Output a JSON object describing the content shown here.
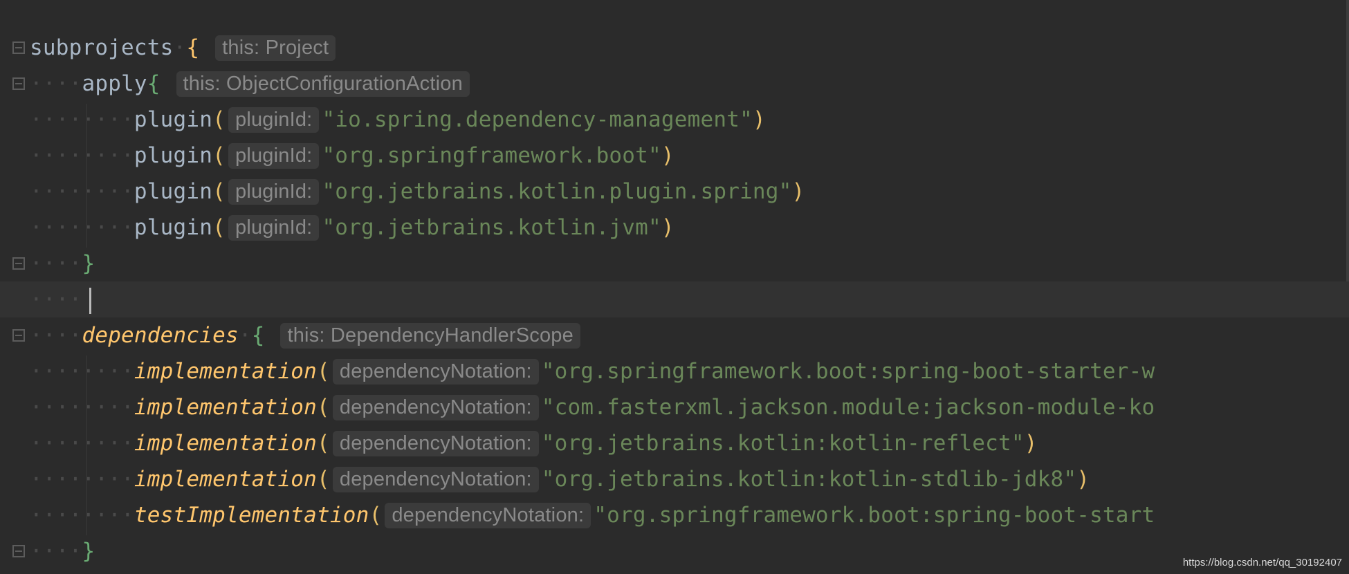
{
  "code": {
    "subprojects": "subprojects",
    "subprojects_hint": "this: Project",
    "apply": "apply",
    "apply_hint": "this: ObjectConfigurationAction",
    "plugin_fn": "plugin",
    "plugin_param": "pluginId:",
    "plugins": [
      "\"io.spring.dependency-management\"",
      "\"org.springframework.boot\"",
      "\"org.jetbrains.kotlin.plugin.spring\"",
      "\"org.jetbrains.kotlin.jvm\""
    ],
    "dependencies": "dependencies",
    "dependencies_hint": "this: DependencyHandlerScope",
    "dep_param": "dependencyNotation:",
    "impl_fn": "implementation",
    "test_impl_fn": "testImplementation",
    "deps": [
      "\"org.springframework.boot:spring-boot-starter-w",
      "\"com.fasterxml.jackson.module:jackson-module-ko",
      "\"org.jetbrains.kotlin:kotlin-reflect\"",
      "\"org.jetbrains.kotlin:kotlin-stdlib-jdk8\""
    ],
    "test_dep": "\"org.springframework.boot:spring-boot-start"
  },
  "watermark": "https://blog.csdn.net/qq_30192407"
}
